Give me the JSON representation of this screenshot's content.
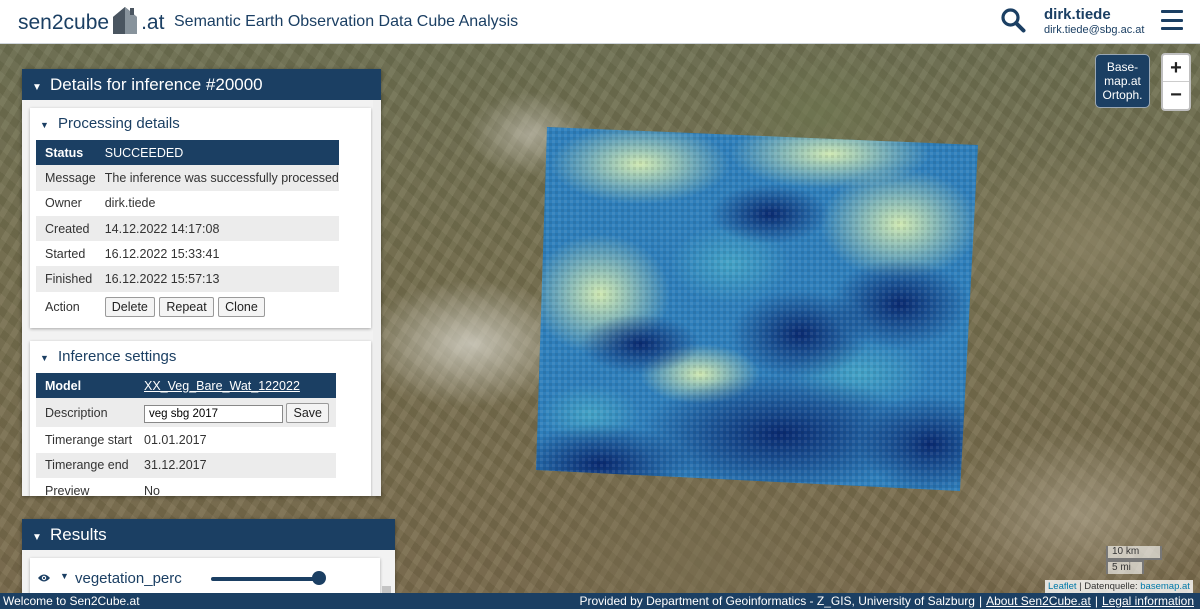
{
  "header": {
    "logo_left": "sen2cube",
    "logo_right": ".at",
    "title": "Semantic Earth Observation Data Cube Analysis",
    "search_icon": "search-icon",
    "menu_icon": "hamburger-menu-icon",
    "user_name": "dirk.tiede",
    "user_email": "dirk.tiede@sbg.ac.at"
  },
  "map_controls": {
    "basemap_line1": "Base-",
    "basemap_line2": "map.at",
    "basemap_line3": "Ortoph.",
    "zoom_in": "+",
    "zoom_out": "−",
    "scale_km": "10 km",
    "scale_mi": "5 mi",
    "attribution_leaflet": "Leaflet",
    "attribution_sep": " | Datenquelle: ",
    "attribution_source": "basemap.at"
  },
  "details": {
    "title": "Details for inference #20000",
    "processing": {
      "title": "Processing details",
      "rows": [
        {
          "key": "Status",
          "value": "SUCCEEDED"
        },
        {
          "key": "Message",
          "value": "The inference was successfully processed"
        },
        {
          "key": "Owner",
          "value": "dirk.tiede"
        },
        {
          "key": "Created",
          "value": "14.12.2022 14:17:08"
        },
        {
          "key": "Started",
          "value": "16.12.2022 15:33:41"
        },
        {
          "key": "Finished",
          "value": "16.12.2022 15:57:13"
        }
      ],
      "action_label": "Action",
      "actions": [
        "Delete",
        "Repeat",
        "Clone"
      ]
    },
    "settings": {
      "title": "Inference settings",
      "model_label": "Model",
      "model_value": "XX_Veg_Bare_Wat_122022",
      "description_label": "Description",
      "description_value": "veg sbg 2017",
      "save_label": "Save",
      "timerange_start_label": "Timerange start",
      "timerange_start_value": "01.01.2017",
      "timerange_end_label": "Timerange end",
      "timerange_end_value": "31.12.2017",
      "preview_label": "Preview",
      "preview_value": "No"
    }
  },
  "results": {
    "title": "Results",
    "item_name": "vegetation_perc",
    "opacity": 1.0
  },
  "footer": {
    "left": "Welcome to Sen2Cube.at",
    "provided_by": "Provided by Department of Geoinformatics - Z_GIS, University of Salzburg",
    "about_link": "About Sen2Cube.at",
    "legal_link": "Legal information"
  },
  "colors": {
    "brand": "#1b3f63",
    "overlay_low": "#0c2a6e",
    "overlay_mid": "#2a86bf",
    "overlay_high": "#d6ecb0"
  }
}
